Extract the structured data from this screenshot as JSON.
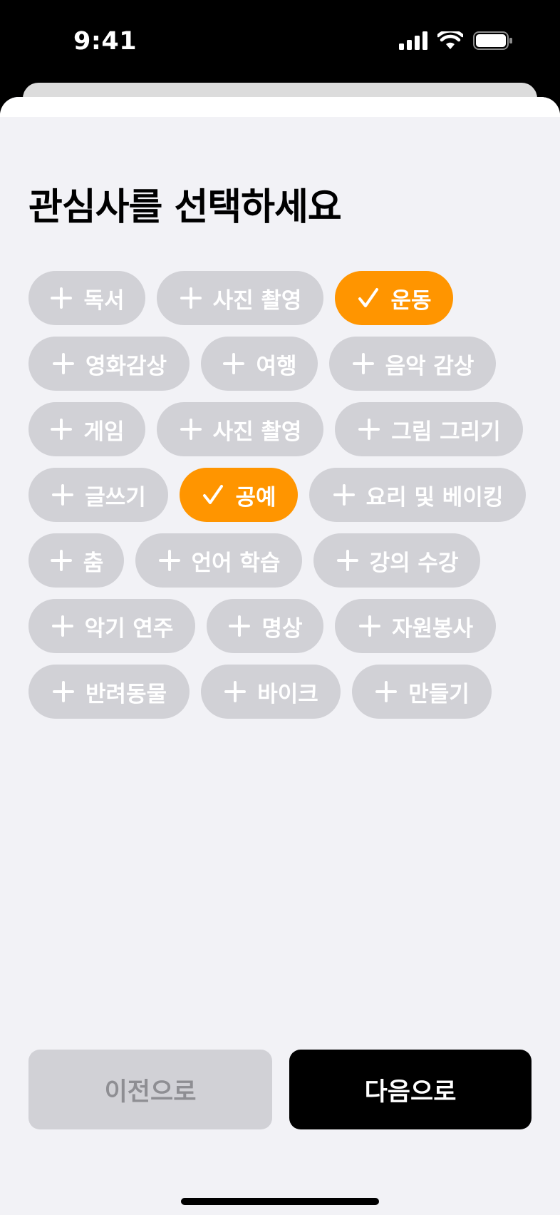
{
  "status_bar": {
    "time": "9:41",
    "icons": [
      "cellular-signal-icon",
      "wifi-icon",
      "battery-icon"
    ]
  },
  "title": "관심사를 선택하세요",
  "colors": {
    "selected": "#ff9500",
    "unselected": "#d1d1d6",
    "background": "#f2f2f6",
    "primary_button": "#000000"
  },
  "chip_icons": {
    "unselected": "plus-icon",
    "selected": "checkmark-icon"
  },
  "chip_rows": [
    [
      {
        "label": "독서",
        "selected": false
      },
      {
        "label": "사진 촬영",
        "selected": false
      },
      {
        "label": "운동",
        "selected": true
      }
    ],
    [
      {
        "label": "영화감상",
        "selected": false
      },
      {
        "label": "여행",
        "selected": false
      },
      {
        "label": "음악 감상",
        "selected": false
      }
    ],
    [
      {
        "label": "게임",
        "selected": false
      },
      {
        "label": "사진 촬영",
        "selected": false
      },
      {
        "label": "그림 그리기",
        "selected": false
      }
    ],
    [
      {
        "label": "글쓰기",
        "selected": false
      },
      {
        "label": "공예",
        "selected": true
      },
      {
        "label": "요리 및 베이킹",
        "selected": false
      }
    ],
    [
      {
        "label": "춤",
        "selected": false
      },
      {
        "label": "언어 학습",
        "selected": false
      },
      {
        "label": "강의 수강",
        "selected": false
      }
    ],
    [
      {
        "label": "악기 연주",
        "selected": false
      },
      {
        "label": "명상",
        "selected": false
      },
      {
        "label": "자원봉사",
        "selected": false
      }
    ],
    [
      {
        "label": "반려동물",
        "selected": false
      },
      {
        "label": "바이크",
        "selected": false
      },
      {
        "label": "만들기",
        "selected": false
      }
    ]
  ],
  "buttons": {
    "prev_label": "이전으로",
    "next_label": "다음으로"
  }
}
